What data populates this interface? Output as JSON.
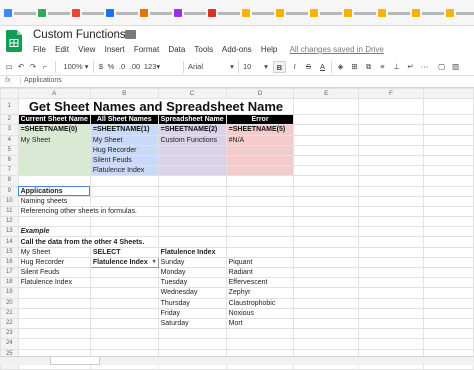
{
  "doc": {
    "title": "Custom Functions",
    "menu": [
      "File",
      "Edit",
      "View",
      "Insert",
      "Format",
      "Data",
      "Tools",
      "Add-ons",
      "Help"
    ],
    "saved_status": "All changes saved in Drive"
  },
  "toolbar": {
    "zoom": "100%",
    "currency": "$",
    "percent": "%",
    "dec_less": ".0",
    "dec_more": ".00",
    "more_formats": "123",
    "font": "Arial",
    "font_size": "10",
    "bold": "B",
    "italic": "I",
    "strike": "S",
    "text_color": "A"
  },
  "formula_bar": {
    "fx": "fx",
    "value": "Applications"
  },
  "grid": {
    "columns": [
      "A",
      "B",
      "C",
      "D",
      "E",
      "F",
      "G"
    ],
    "rows": [
      "1",
      "2",
      "3",
      "4",
      "5",
      "6",
      "7",
      "8",
      "9",
      "10",
      "11",
      "12",
      "13",
      "14",
      "15",
      "16",
      "17",
      "18",
      "19",
      "20",
      "21",
      "22",
      "23",
      "24",
      "25",
      "26"
    ],
    "title": "Get Sheet Names and Spreadsheet Name",
    "headers": [
      "Current Sheet Name",
      "All Sheet Names",
      "Spreadsheet Name",
      "Error"
    ],
    "formulas": [
      "=SHEETNAME(0)",
      "=SHEETNAME(1)",
      "=SHEETNAME(2)",
      "=SHEETNAME(5)"
    ],
    "r4": [
      "My Sheet",
      "My Sheet",
      "Custom Functions",
      "#N/A"
    ],
    "r5_b": "Hug Recorder",
    "r6_b": "Silent Feuds",
    "r7_b": "Flatulence Index",
    "r9_a": "Applications",
    "r10_a": "Naming sheets",
    "r11_a": "Referencing other sheets in formulas.",
    "r13_a": "Example",
    "r14_a": "Call the data from the other 4 Sheets.",
    "r15": [
      "My Sheet",
      "SELECT",
      "Flatulence Index"
    ],
    "r16": [
      "Hug Recorder",
      "Flatulence Index",
      "Sunday",
      "Piquant"
    ],
    "r17": [
      "Silent Feuds",
      "Monday",
      "Radiant"
    ],
    "r18": [
      "Flatulence Index",
      "Tuesday",
      "Effervescent"
    ],
    "r19": [
      "Wednesday",
      "Zephyr"
    ],
    "r20": [
      "Thursday",
      "Claustrophobic"
    ],
    "r21": [
      "Friday",
      "Noxious"
    ],
    "r22": [
      "Saturday",
      "Mort"
    ]
  },
  "colors": {
    "header_bg": "#000000",
    "green": "#d9ead3",
    "blue": "#c9daf8",
    "purple": "#d9d2e9",
    "red": "#f4cccc",
    "selection": "#4a86e8"
  }
}
